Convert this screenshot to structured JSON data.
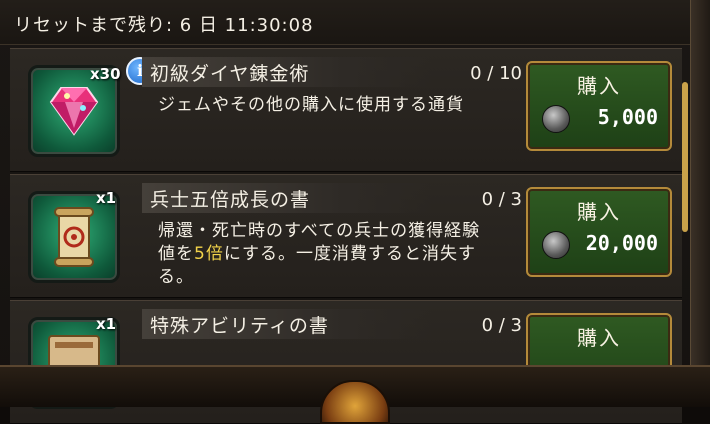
{
  "header": {
    "reset_text": "リセットまで残り: 6 日 11:30:08"
  },
  "items": [
    {
      "title": "初級ダイヤ錬金術",
      "quantity": "x30",
      "count": "0 / 10",
      "desc_parts": [
        "ジェムやその他の購入に使用する通貨"
      ],
      "buy_label": "購入",
      "price": "5,000",
      "icon": "gem-icon",
      "has_info": true
    },
    {
      "title": "兵士五倍成長の書",
      "quantity": "x1",
      "count": "0 / 3",
      "desc_before": "帰還・死亡時のすべての兵士の獲得経験値を",
      "desc_highlight": "5倍",
      "desc_after": "にする。一度消費すると消失する。",
      "buy_label": "購入",
      "price": "20,000",
      "icon": "scroll-icon"
    },
    {
      "title": "特殊アビリティの書",
      "quantity": "x1",
      "count": "0 / 3",
      "buy_label": "購入",
      "icon": "book-icon"
    }
  ],
  "info_glyph": "i",
  "colors": {
    "button_green": "#2f5a22",
    "highlight": "#f2d34a",
    "gold_border": "#b48a3a"
  }
}
